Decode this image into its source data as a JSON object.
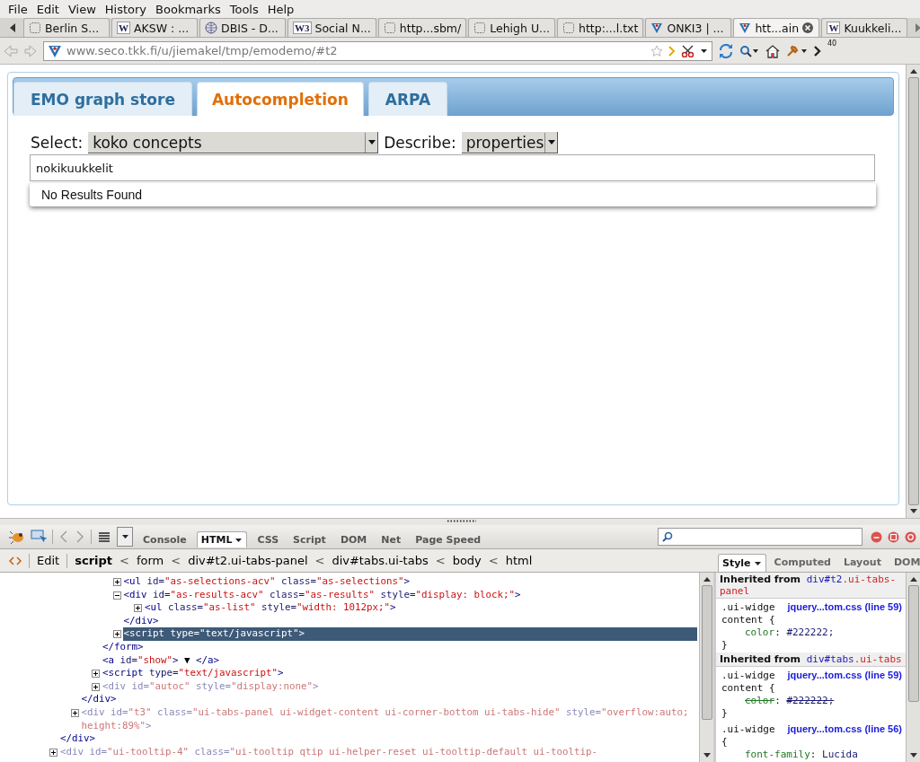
{
  "menu_bar": [
    "File",
    "Edit",
    "View",
    "History",
    "Bookmarks",
    "Tools",
    "Help"
  ],
  "browser_tabs": [
    {
      "label": "Berlin S...",
      "kind": "page",
      "selected": false
    },
    {
      "label": "AKSW : ...",
      "kind": "letter",
      "icon_text": "W",
      "selected": false
    },
    {
      "label": "DBIS - D...",
      "kind": "globe",
      "selected": false
    },
    {
      "label": "Social N...",
      "kind": "letter",
      "icon_text": "W3",
      "selected": false
    },
    {
      "label": "http...sbm/",
      "kind": "page",
      "selected": false
    },
    {
      "label": "Lehigh U...",
      "kind": "page",
      "selected": false
    },
    {
      "label": "http:...l.txt",
      "kind": "page",
      "selected": false
    },
    {
      "label": "ONKI3 | ...",
      "kind": "seco",
      "selected": false
    },
    {
      "label": "htt...ain",
      "kind": "seco",
      "selected": true
    },
    {
      "label": "Kuukkeli...",
      "kind": "letter",
      "icon_text": "W",
      "selected": false
    }
  ],
  "address_bar": {
    "url": "www.seco.tkk.fi/u/jiemakel/tmp/emodemo/#t2"
  },
  "toolbar_badge": "40",
  "page": {
    "tabs": [
      {
        "label": "EMO graph store",
        "selected": false
      },
      {
        "label": "Autocompletion",
        "selected": true
      },
      {
        "label": "ARPA",
        "selected": false
      }
    ],
    "select": {
      "label": "Select:",
      "value": "koko concepts"
    },
    "describe": {
      "label": "Describe:",
      "value": "properties"
    },
    "search": {
      "value": "nokikuukkelit"
    },
    "results": [
      "No Results Found"
    ]
  },
  "firebug": {
    "panel_tabs": [
      {
        "label": "Console",
        "selected": false
      },
      {
        "label": "HTML",
        "selected": true
      },
      {
        "label": "CSS",
        "selected": false
      },
      {
        "label": "Script",
        "selected": false
      },
      {
        "label": "DOM",
        "selected": false
      },
      {
        "label": "Net",
        "selected": false
      },
      {
        "label": "Page Speed",
        "selected": false
      }
    ],
    "edit_button": "Edit",
    "breadcrumb": [
      {
        "kind": "node",
        "label": "script",
        "selected": true
      },
      {
        "kind": "separator",
        "label": "<"
      },
      {
        "kind": "node",
        "label": "form",
        "selected": false
      },
      {
        "kind": "separator",
        "label": "<"
      },
      {
        "kind": "node",
        "label": "div#t2.ui-tabs-panel",
        "selected": false
      },
      {
        "kind": "separator",
        "label": "<"
      },
      {
        "kind": "node",
        "label": "div#tabs.ui-tabs",
        "selected": false
      },
      {
        "kind": "separator",
        "label": "<"
      },
      {
        "kind": "node",
        "label": "body",
        "selected": false
      },
      {
        "kind": "separator",
        "label": "<"
      },
      {
        "kind": "node",
        "label": "html",
        "selected": false
      }
    ],
    "side_tabs": [
      {
        "label": "Style",
        "selected": true
      },
      {
        "label": "Computed",
        "selected": false
      },
      {
        "label": "Layout",
        "selected": false
      },
      {
        "label": "DOM",
        "selected": false
      }
    ],
    "html_tree": [
      {
        "children": [
          {
            "children": [
              {
                "children": [
                  {
                    "expanded": false,
                    "selected": false,
                    "hidden": false,
                    "parts": [
                      {
                        "kind": "tag",
                        "text": "<ul"
                      },
                      {
                        "kind": "attr",
                        "text": " id="
                      },
                      {
                        "kind": "value",
                        "text": "\"as-selections-acv\""
                      },
                      {
                        "kind": "attr",
                        "text": " class="
                      },
                      {
                        "kind": "value",
                        "text": "\"as-selections\""
                      },
                      {
                        "kind": "tag",
                        "text": ">"
                      }
                    ]
                  },
                  {
                    "expanded": true,
                    "selected": false,
                    "hidden": false,
                    "parts": [
                      {
                        "kind": "tag",
                        "text": "<div"
                      },
                      {
                        "kind": "attr",
                        "text": " id="
                      },
                      {
                        "kind": "value",
                        "text": "\"as-results-acv\""
                      },
                      {
                        "kind": "attr",
                        "text": " class="
                      },
                      {
                        "kind": "value",
                        "text": "\"as-results\""
                      },
                      {
                        "kind": "attr",
                        "text": " style="
                      },
                      {
                        "kind": "value",
                        "text": "\"display: block;\""
                      },
                      {
                        "kind": "tag",
                        "text": ">"
                      }
                    ],
                    "children": [
                      {
                        "expanded": false,
                        "selected": false,
                        "hidden": false,
                        "parts": [
                          {
                            "kind": "tag",
                            "text": "<ul"
                          },
                          {
                            "kind": "attr",
                            "text": " class="
                          },
                          {
                            "kind": "value",
                            "text": "\"as-list\""
                          },
                          {
                            "kind": "attr",
                            "text": " style="
                          },
                          {
                            "kind": "value",
                            "text": "\"width: 1012px;\""
                          },
                          {
                            "kind": "tag",
                            "text": ">"
                          }
                        ]
                      }
                    ],
                    "close": [
                      {
                        "kind": "tag",
                        "text": "</div>"
                      }
                    ]
                  },
                  {
                    "expanded": false,
                    "selected": true,
                    "hidden": false,
                    "parts": [
                      {
                        "kind": "tag",
                        "text": "<script"
                      },
                      {
                        "kind": "attr",
                        "text": " type="
                      },
                      {
                        "kind": "value",
                        "text": "\"text/javascript\""
                      },
                      {
                        "kind": "tag",
                        "text": ">"
                      }
                    ]
                  }
                ],
                "close": [
                  {
                    "kind": "tag",
                    "text": "</form>"
                  }
                ]
              },
              {
                "selected": false,
                "hidden": false,
                "parts": [
                  {
                    "kind": "tag",
                    "text": "<a"
                  },
                  {
                    "kind": "attr",
                    "text": " id="
                  },
                  {
                    "kind": "value",
                    "text": "\"show\""
                  },
                  {
                    "kind": "tag",
                    "text": ">"
                  },
                  {
                    "kind": "text",
                    "text": " ▼ "
                  },
                  {
                    "kind": "tag",
                    "text": "</a>"
                  }
                ]
              },
              {
                "expanded": false,
                "selected": false,
                "hidden": false,
                "parts": [
                  {
                    "kind": "tag",
                    "text": "<script"
                  },
                  {
                    "kind": "attr",
                    "text": " type="
                  },
                  {
                    "kind": "value",
                    "text": "\"text/javascript\""
                  },
                  {
                    "kind": "tag",
                    "text": ">"
                  }
                ]
              },
              {
                "expanded": false,
                "selected": false,
                "hidden": true,
                "parts": [
                  {
                    "kind": "tag",
                    "text": "<div"
                  },
                  {
                    "kind": "attr",
                    "text": " id="
                  },
                  {
                    "kind": "value",
                    "text": "\"autoc\""
                  },
                  {
                    "kind": "attr",
                    "text": " style="
                  },
                  {
                    "kind": "value",
                    "text": "\"display:none\""
                  },
                  {
                    "kind": "tag",
                    "text": ">"
                  }
                ]
              }
            ],
            "close": [
              {
                "kind": "tag",
                "text": "</div>"
              }
            ]
          },
          {
            "expanded": false,
            "selected": false,
            "hidden": true,
            "parts": [
              {
                "kind": "tag",
                "text": "<div"
              },
              {
                "kind": "attr",
                "text": " id="
              },
              {
                "kind": "value",
                "text": "\"t3\""
              },
              {
                "kind": "attr",
                "text": " class="
              },
              {
                "kind": "value",
                "text": "\"ui-tabs-panel ui-widget-content ui-corner-bottom ui-tabs-hide\""
              },
              {
                "kind": "attr",
                "text": " style="
              },
              {
                "kind": "value",
                "text": "\"overflow:auto; height:89%\""
              },
              {
                "kind": "tag",
                "text": ">"
              }
            ]
          }
        ],
        "close": [
          {
            "kind": "tag",
            "text": "</div>"
          }
        ]
      },
      {
        "expanded": false,
        "selected": false,
        "hidden": true,
        "parts": [
          {
            "kind": "tag",
            "text": "<div"
          },
          {
            "kind": "attr",
            "text": " id="
          },
          {
            "kind": "value",
            "text": "\"ui-tooltip-4\""
          },
          {
            "kind": "attr",
            "text": " class="
          },
          {
            "kind": "value",
            "text": "\"ui-tooltip qtip ui-helper-reset ui-tooltip-default ui-tooltip-"
          }
        ]
      }
    ],
    "style_sections": [
      {
        "heading": "Inherited from",
        "element_id": "div#t2",
        "element_class": ".ui-tabs-panel",
        "rules": [
          {
            "selector": [
              ".ui-widge",
              "content {"
            ],
            "source": "jquery...tom.css (line 59)",
            "props": [
              {
                "name": "color",
                "sep": ":",
                "value": "#222222;",
                "overridden": false
              }
            ],
            "close": "}"
          }
        ]
      },
      {
        "heading": "Inherited from",
        "element_id": "div#tabs",
        "element_class": ".ui-tabs",
        "rules": [
          {
            "selector": [
              ".ui-widge",
              "content {"
            ],
            "source": "jquery...tom.css (line 59)",
            "props": [
              {
                "name": "color",
                "sep": ":",
                "value": "#222222;",
                "overridden": true
              }
            ],
            "close": "}"
          },
          {
            "selector": [
              ".ui-widge",
              "{"
            ],
            "source": "jquery...tom.css (line 56)",
            "props": [
              {
                "name": "font-family",
                "sep": ":",
                "value": "Lucida",
                "overridden": false
              }
            ]
          }
        ]
      }
    ]
  }
}
